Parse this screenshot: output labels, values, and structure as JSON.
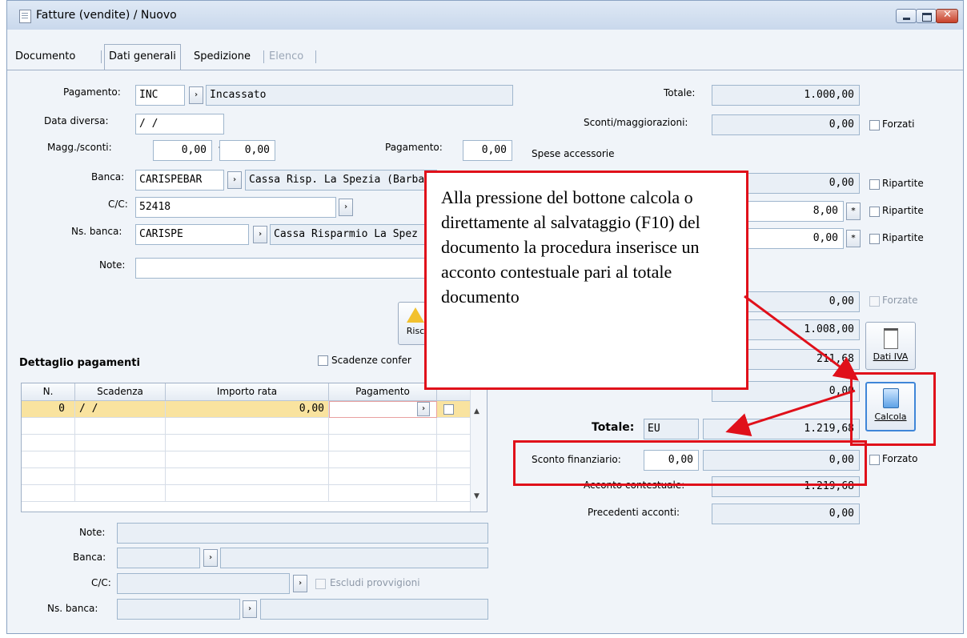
{
  "window": {
    "title": "Fatture (vendite) / Nuovo"
  },
  "tabs": [
    {
      "label": "Documento"
    },
    {
      "label": "Dati generali"
    },
    {
      "label": "Spedizione"
    },
    {
      "label": "Elenco"
    }
  ],
  "left": {
    "pagamento_label": "Pagamento:",
    "pagamento_code": "INC",
    "pagamento_desc": "Incassato",
    "data_diversa_label": "Data diversa:",
    "data_diversa_value": " /  /",
    "magg_label": "Magg./sconti:",
    "magg_value1": "0,00",
    "plus": "+",
    "magg_value2": "0,00",
    "pagamento2_label": "Pagamento:",
    "pagamento2_value": "0,00",
    "banca_label": "Banca:",
    "banca_code": "CARISPEBAR",
    "banca_desc": "Cassa Risp. La Spezia (Barba",
    "cc_label": "C/C:",
    "cc_value": "52418",
    "nsbanca_label": "Ns. banca:",
    "nsbanca_code": "CARISPE",
    "nsbanca_desc": "Cassa Risparmio La Spez",
    "note_label": "Note:",
    "note_value": "",
    "ricalcola_label": "Risc"
  },
  "right": {
    "totale_label": "Totale:",
    "totale_value": "1.000,00",
    "sconti_label": "Sconti/maggiorazioni:",
    "sconti_value": "0,00",
    "forzati_label": "Forzati",
    "spese_label": "Spese accessorie",
    "spese_value1": "0,00",
    "spese_value2": "8,00",
    "spese_value3": "0,00",
    "ripartite_label": "Ripartite",
    "value4": "0,00",
    "forzate_label": "Forzate",
    "value5": "1.008,00",
    "value6": "211,68",
    "value7": "0,00",
    "dati_iva_label": "Dati IVA",
    "calcola_label": "Calcola",
    "totale2_label": "Totale:",
    "valuta": "EU",
    "totale2_value": "1.219,68",
    "sconto_fin_label": "Sconto finanziario:",
    "sconto_fin_value1": "0,00",
    "sconto_fin_value2": "0,00",
    "forzato_label": "Forzato",
    "acconto_label": "Acconto contestuale:",
    "acconto_value": "1.219,68",
    "precedenti_label": "Precedenti acconti:",
    "precedenti_value": "0,00"
  },
  "dettaglio": {
    "title": "Dettaglio pagamenti",
    "scadenze_label": "Scadenze confer",
    "columns": [
      "N.",
      "Scadenza",
      "Importo rata",
      "Pagamento"
    ],
    "rows": [
      {
        "n": "0",
        "scadenza": " /  /",
        "importo": "0,00",
        "pagamento": ""
      }
    ],
    "note_label": "Note:",
    "banca_label": "Banca:",
    "cc_label": "C/C:",
    "escludi_label": "Escludi provvigioni",
    "nsbanca_label": "Ns. banca:"
  },
  "annotation": {
    "text": "Alla pressione del bottone calcola o direttamente al salvataggio (F10) del documento la procedura inserisce un acconto contestuale pari al totale documento"
  },
  "colors": {
    "annotation_red": "#e0101a",
    "selected_row": "#f9e39f"
  }
}
